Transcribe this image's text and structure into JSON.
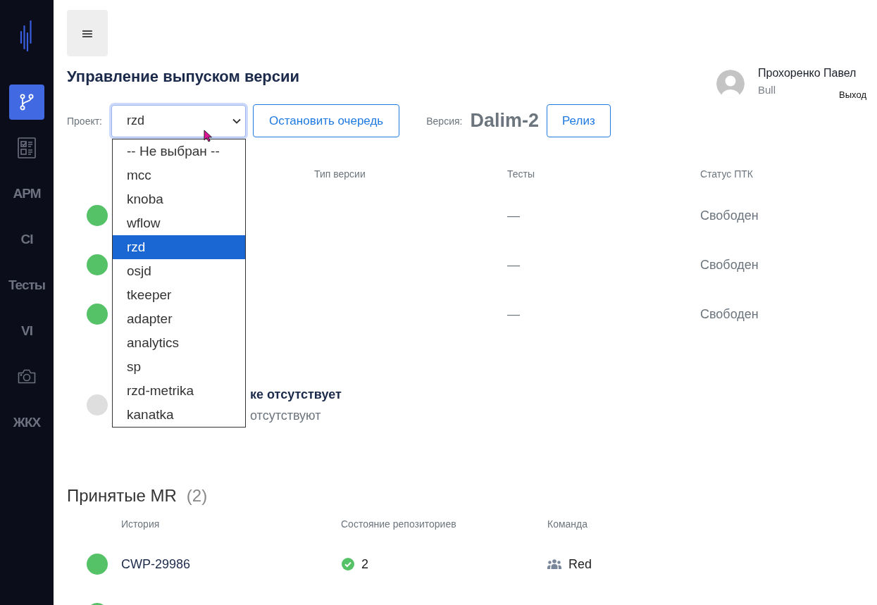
{
  "sidebar": {
    "items": [
      {
        "kind": "branch",
        "selected": true
      },
      {
        "kind": "checklist",
        "selected": false
      },
      {
        "kind": "text",
        "label": "АРМ",
        "selected": false
      },
      {
        "kind": "text",
        "label": "CI",
        "selected": false
      },
      {
        "kind": "text",
        "label": "Тесты",
        "selected": false
      },
      {
        "kind": "text",
        "label": "VI",
        "selected": false
      },
      {
        "kind": "camera",
        "selected": false
      },
      {
        "kind": "text",
        "label": "ЖКХ",
        "selected": false
      }
    ]
  },
  "menu_button": {
    "label": "≡"
  },
  "title": "Управление выпуском версии",
  "user": {
    "name": "Прохоренко Павел",
    "role": "Bull",
    "logout": "Выход"
  },
  "controls": {
    "project_label": "Проект:",
    "project_select": {
      "value": "rzd",
      "focused": true,
      "expanded": true,
      "options": [
        {
          "label": "-- Не выбран --",
          "selected": false
        },
        {
          "label": "mcc",
          "selected": false
        },
        {
          "label": "knoba",
          "selected": false
        },
        {
          "label": "wflow",
          "selected": false
        },
        {
          "label": "rzd",
          "selected": true
        },
        {
          "label": "osjd",
          "selected": false
        },
        {
          "label": "tkeeper",
          "selected": false
        },
        {
          "label": "adapter",
          "selected": false
        },
        {
          "label": "analytics",
          "selected": false
        },
        {
          "label": "sp",
          "selected": false
        },
        {
          "label": "rzd-metrika",
          "selected": false
        },
        {
          "label": "kanatka",
          "selected": false
        }
      ]
    },
    "stop_button": "Остановить очередь",
    "version_label": "Версия:",
    "version": "Dalim-2",
    "release_button": "Релиз"
  },
  "releases": {
    "columns": [
      "Тип версии",
      "Тесты",
      "Статус ПТК"
    ],
    "rows": [
      {
        "color": "#55c267",
        "tests": "—",
        "ptk_status": "Свободен"
      },
      {
        "color": "#55c267",
        "tests": "—",
        "ptk_status": "Свободен"
      },
      {
        "color": "#55c267",
        "tests": "—",
        "ptk_status": "Свободен"
      }
    ],
    "empty": {
      "color": "#dedede",
      "title": "ке отсутствует",
      "subtitle": "отсутствуют"
    }
  },
  "accepted_mr": {
    "title": "Принятые MR",
    "count": "(2)",
    "columns": [
      "История",
      "Состояние репозиториев",
      "Команда"
    ],
    "rows": [
      {
        "color": "#55c267",
        "story": "CWP-29986",
        "repos": "2",
        "team": "Red"
      },
      {
        "color": "#55c267"
      }
    ]
  }
}
